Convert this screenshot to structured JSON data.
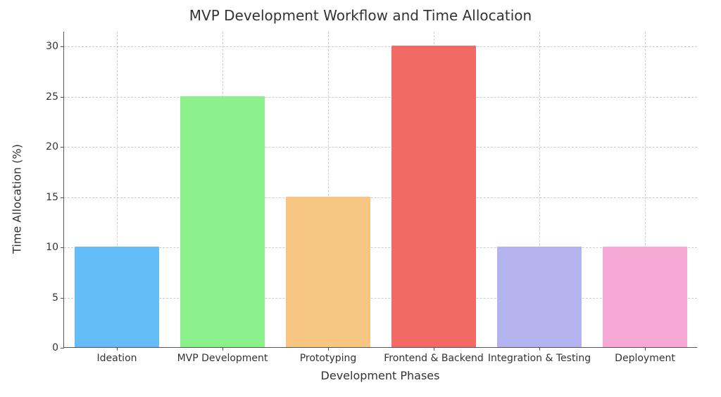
{
  "chart_data": {
    "type": "bar",
    "title": "MVP Development Workflow and Time Allocation",
    "xlabel": "Development Phases",
    "ylabel": "Time Allocation (%)",
    "categories": [
      "Ideation",
      "MVP Development",
      "Prototyping",
      "Frontend & Backend",
      "Integration & Testing",
      "Deployment"
    ],
    "values": [
      10,
      25,
      15,
      30,
      10,
      10
    ],
    "colors": [
      "#65bdf7",
      "#8cf08c",
      "#f7c682",
      "#f26a63",
      "#b3b3ef",
      "#f7a9d5"
    ],
    "ylim": [
      0,
      31.5
    ],
    "yticks": [
      0,
      5,
      10,
      15,
      20,
      25,
      30
    ],
    "grid": true
  }
}
